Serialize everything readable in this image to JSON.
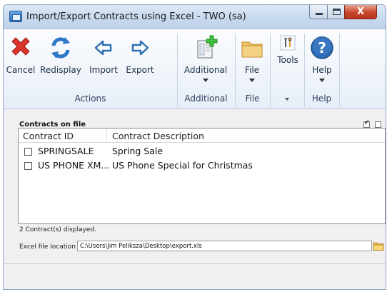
{
  "window": {
    "title": "Import/Export Contracts using Excel  -  TWO (sa)",
    "close_glyph": "X",
    "title_icon": "app-window-icon"
  },
  "ribbon": {
    "buttons": [
      {
        "label": "Cancel",
        "icon": "cancel-icon"
      },
      {
        "label": "Redisplay",
        "icon": "redisplay-icon"
      },
      {
        "label": "Import",
        "icon": "import-arrow-left-icon"
      },
      {
        "label": "Export",
        "icon": "export-arrow-right-icon"
      },
      {
        "label": "Additional",
        "icon": "additional-icon"
      },
      {
        "label": "File",
        "icon": "folder-icon"
      },
      {
        "label": "Tools",
        "icon": "tools-icon"
      },
      {
        "label": "Help",
        "icon": "help-icon"
      }
    ],
    "groups": [
      "Actions",
      "Additional",
      "File",
      "Help"
    ],
    "accent": "#3a6db5"
  },
  "contracts": {
    "section_title": "Contracts on file",
    "columns": [
      "Contract ID",
      "Contract Description"
    ],
    "rows": [
      {
        "id": "SPRINGSALE",
        "description": "Spring Sale",
        "checked": false
      },
      {
        "id": "US PHONE XM...",
        "description": "US Phone Special for Christmas",
        "checked": false
      }
    ],
    "mark_all_checked": true,
    "unmark_all_checked": false,
    "status": "2 Contract(s) displayed."
  },
  "file": {
    "label": "Excel file location",
    "path": "C:\\Users\\Jim Peliksza\\Desktop\\export.xls"
  }
}
